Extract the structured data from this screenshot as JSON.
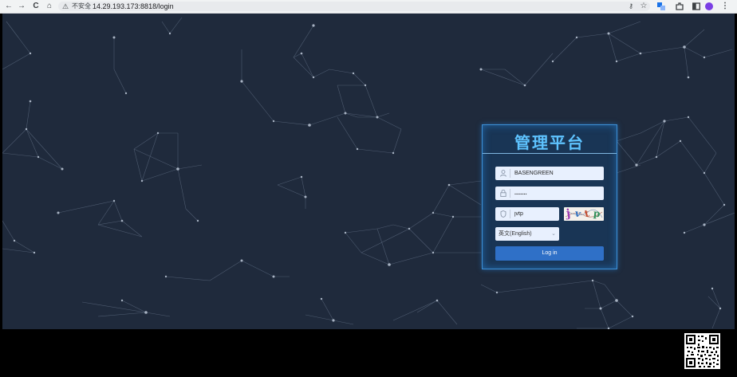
{
  "browser": {
    "nav": {
      "back": "←",
      "forward": "→",
      "reload": "C",
      "home": "⌂"
    },
    "security_label": "不安全",
    "url": "14.29.193.173:8818/login",
    "toolbar_icons": [
      "key-icon",
      "star-icon",
      "translate-icon",
      "extensions-icon",
      "sidepanel-icon",
      "profile-icon",
      "menu-icon"
    ]
  },
  "login": {
    "title": "管理平台",
    "username": "BASENGREEN",
    "password": "........",
    "captcha_input": "jvtp",
    "captcha_image_text": "jvtp",
    "language": "英文(English)",
    "login_button": "Log in"
  },
  "colors": {
    "background": "#1f2a3c",
    "panel": "#18385c",
    "panel_border": "#3d8fd6",
    "title": "#5ec3ff",
    "button": "#2f70c7"
  }
}
